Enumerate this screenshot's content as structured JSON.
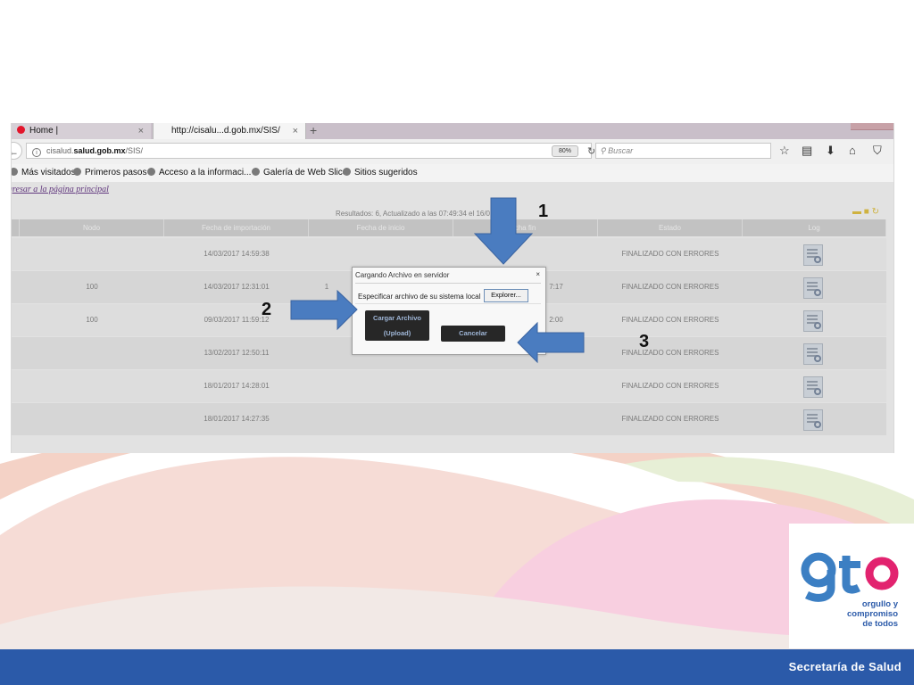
{
  "browser": {
    "tabs": [
      {
        "label": "Home |",
        "active": false
      },
      {
        "label": "http://cisalu...d.gob.mx/SIS/",
        "active": true
      }
    ],
    "new_tab_symbol": "+",
    "tab_close_symbol": "×",
    "url": {
      "prefix": "cisalud.",
      "domain": "salud.gob.mx",
      "path": "/SIS/"
    },
    "zoom": "80%",
    "search_placeholder": "Buscar",
    "bookmarks": [
      "Más visitados",
      "Primeros pasos",
      "Acceso a la informaci...",
      "Galería de Web Slice",
      "Sitios sugeridos"
    ]
  },
  "page": {
    "back_link": "gresar a la página principal",
    "results_text": "Resultados: 6, Actualizado a las 07:49:34 el 16/0",
    "columns": [
      "",
      "Nodo",
      "Fecha de importación",
      "Fecha de inicio",
      "cha fin",
      "Estado",
      "Log"
    ],
    "rows": [
      {
        "nodo": "",
        "importacion": "14/03/2017 14:59:38",
        "inicio": "",
        "fin": "",
        "estado": "FINALIZADO CON ERRORES"
      },
      {
        "nodo": "100",
        "importacion": "14/03/2017 12:31:01",
        "inicio": "1",
        "fin": "7:17",
        "estado": "FINALIZADO CON ERRORES"
      },
      {
        "nodo": "100",
        "importacion": "09/03/2017 11:59:12",
        "inicio": "",
        "fin": "2:00",
        "estado": "FINALIZADO CON ERRORES"
      },
      {
        "nodo": "",
        "importacion": "13/02/2017 12:50:11",
        "inicio": "",
        "fin": "",
        "estado": "FINALIZADO CON ERRORES"
      },
      {
        "nodo": "",
        "importacion": "18/01/2017 14:28:01",
        "inicio": "",
        "fin": "",
        "estado": "FINALIZADO CON ERRORES"
      },
      {
        "nodo": "",
        "importacion": "18/01/2017 14:27:35",
        "inicio": "",
        "fin": "",
        "estado": "FINALIZADO CON ERRORES"
      }
    ]
  },
  "dialog": {
    "title": "Cargando Archivo en servidor",
    "close": "×",
    "label": "Especificar archivo de su sistema local",
    "explorer_button": "Explorer...",
    "upload_line1": "Cargar Archivo",
    "upload_line2": "(Upload)",
    "cancel_button": "Cancelar"
  },
  "annotations": {
    "step1": "1",
    "step2": "2",
    "step3": "3",
    "arrow_color": "#4a7cc0"
  },
  "footer": {
    "text": "Secretaría de Salud",
    "logo_letters": "gto",
    "logo_tagline": [
      "orgullo y",
      "compromiso",
      "de todos"
    ]
  },
  "colors": {
    "footer_blue": "#2b5aa9",
    "arrow_blue": "#4a7cc0",
    "logo_blue": "#3c7fc3",
    "logo_pink": "#e2236f"
  }
}
